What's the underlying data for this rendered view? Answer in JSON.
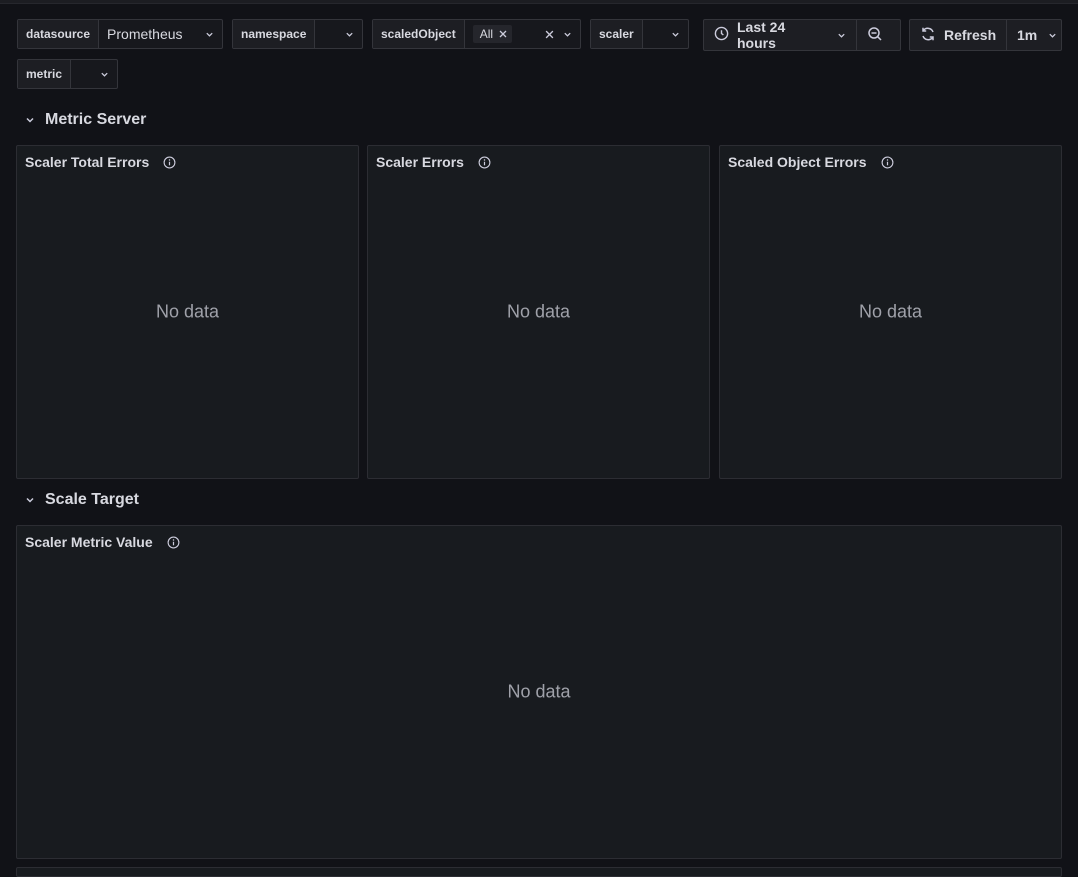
{
  "variables": [
    {
      "label": "datasource",
      "value": "Prometheus"
    },
    {
      "label": "namespace",
      "value": ""
    },
    {
      "label": "scaledObject",
      "value": "All"
    },
    {
      "label": "scaler",
      "value": ""
    },
    {
      "label": "metric",
      "value": ""
    }
  ],
  "time_picker": {
    "range": "Last 24 hours"
  },
  "refresh": {
    "label": "Refresh",
    "interval": "1m"
  },
  "rows": [
    {
      "title": "Metric Server"
    },
    {
      "title": "Scale Target"
    }
  ],
  "panels": [
    {
      "title": "Scaler Total Errors",
      "message": "No data"
    },
    {
      "title": "Scaler Errors",
      "message": "No data"
    },
    {
      "title": "Scaled Object Errors",
      "message": "No data"
    },
    {
      "title": "Scaler Metric Value",
      "message": "No data"
    }
  ],
  "icons": {
    "clock": "clock-icon",
    "zoom_out": "zoom-out-icon",
    "refresh": "refresh-icon",
    "info": "info-icon",
    "chevron": "chevron-down-icon",
    "close": "close-icon"
  },
  "colors": {
    "background": "#111217",
    "panel": "#181b1f",
    "border": "#2c2d33",
    "text": "#d8d9e0",
    "muted": "#9fa1a9"
  }
}
